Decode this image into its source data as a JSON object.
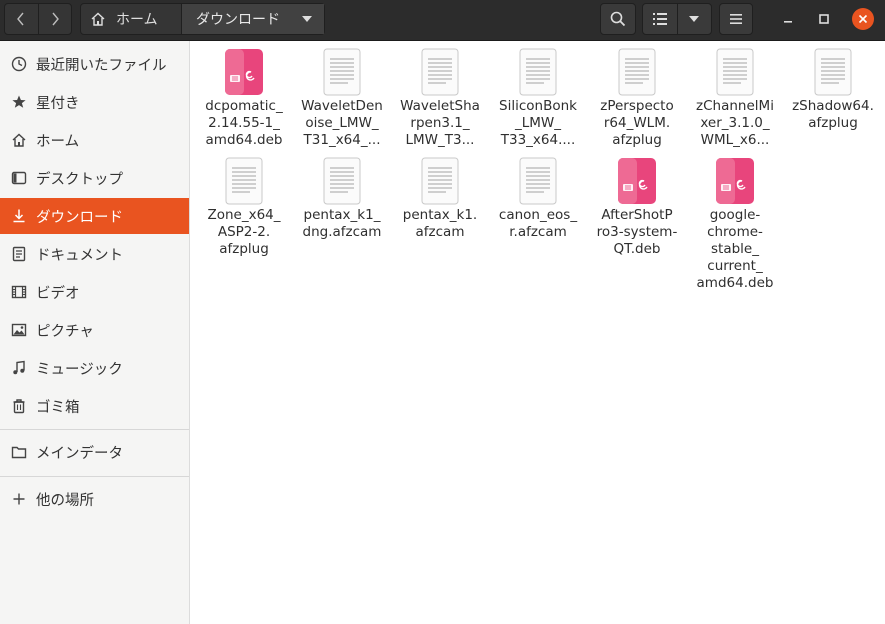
{
  "nav": {
    "back_icon": "chevron-left-icon",
    "forward_icon": "chevron-right-icon"
  },
  "pathbar": {
    "home_label": "ホーム",
    "current_label": "ダウンロード"
  },
  "toolbar": {
    "search_icon": "search-icon",
    "list_view_icon": "list-view-icon",
    "view_options_icon": "chevron-down-icon",
    "menu_icon": "hamburger-menu-icon"
  },
  "window": {
    "minimize": "minimize-icon",
    "maximize": "maximize-icon",
    "close": "close-icon"
  },
  "colors": {
    "accent": "#e95420",
    "header_bg": "#2c2c2c",
    "deb_pink": "#e8457c"
  },
  "sidebar": {
    "items": [
      {
        "label": "最近開いたファイル",
        "icon": "clock-icon"
      },
      {
        "label": "星付き",
        "icon": "star-icon"
      },
      {
        "label": "ホーム",
        "icon": "home-icon"
      },
      {
        "label": "デスクトップ",
        "icon": "desktop-icon"
      },
      {
        "label": "ダウンロード",
        "icon": "download-icon",
        "active": true
      },
      {
        "label": "ドキュメント",
        "icon": "document-icon"
      },
      {
        "label": "ビデオ",
        "icon": "film-icon"
      },
      {
        "label": "ピクチャ",
        "icon": "picture-icon"
      },
      {
        "label": "ミュージック",
        "icon": "music-icon"
      },
      {
        "label": "ゴミ箱",
        "icon": "trash-icon"
      },
      {
        "label": "メインデータ",
        "icon": "folder-icon"
      },
      {
        "label": "他の場所",
        "icon": "plus-icon"
      }
    ]
  },
  "files": [
    {
      "name": "dcpomatic_\n2.14.55-1_\namd64.deb",
      "type": "deb"
    },
    {
      "name": "WaveletDen\noise_LMW_\nT31_x64_...",
      "type": "doc"
    },
    {
      "name": "WaveletSha\nrpen3.1_\nLMW_T3...",
      "type": "doc"
    },
    {
      "name": "SiliconBonk\n_LMW_\nT33_x64....",
      "type": "doc"
    },
    {
      "name": "zPerspecto\nr64_WLM.\nafzplug",
      "type": "doc"
    },
    {
      "name": "zChannelMi\nxer_3.1.0_\nWML_x6...",
      "type": "doc"
    },
    {
      "name": "zShadow64.\nafzplug",
      "type": "doc"
    },
    {
      "name": "Zone_x64_\nASP2-2.\nafzplug",
      "type": "doc"
    },
    {
      "name": "pentax_k1_\ndng.afzcam",
      "type": "doc"
    },
    {
      "name": "pentax_k1.\nafzcam",
      "type": "doc"
    },
    {
      "name": "canon_eos_\nr.afzcam",
      "type": "doc"
    },
    {
      "name": "AfterShotP\nro3-system-\nQT.deb",
      "type": "deb"
    },
    {
      "name": "google-\nchrome-\nstable_\ncurrent_\namd64.deb",
      "type": "deb"
    }
  ]
}
